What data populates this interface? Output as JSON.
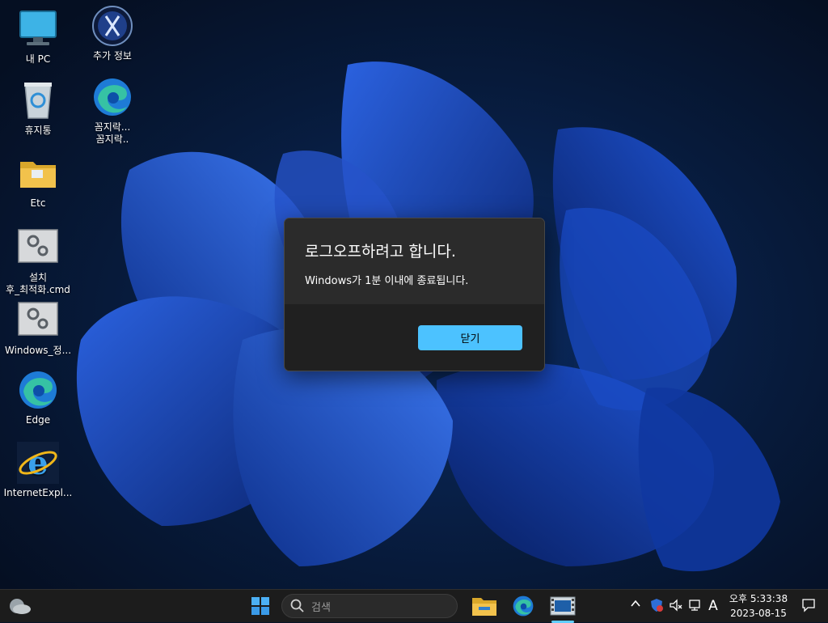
{
  "desktop": {
    "icons": [
      {
        "label": "내 PC",
        "icon": "this-pc-icon"
      },
      {
        "label": "추가 정보",
        "icon": "info-globe-icon"
      },
      {
        "label": "휴지통",
        "icon": "recycle-bin-icon"
      },
      {
        "label": "꼼지락...\n꼼지락..",
        "icon": "edge-icon"
      },
      {
        "label": "Etc",
        "icon": "folder-icon"
      },
      {
        "label": "설치\n후_최적화.cmd",
        "icon": "cmd-settings-icon"
      },
      {
        "label": "Windows_정...",
        "icon": "cmd-settings-icon"
      },
      {
        "label": "Edge",
        "icon": "edge-icon"
      },
      {
        "label": "InternetExpl...",
        "icon": "internet-explorer-icon"
      }
    ]
  },
  "dialog": {
    "title": "로그오프하려고 합니다.",
    "message": "Windows가 1분 이내에 종료됩니다.",
    "close_label": "닫기",
    "button_color": "#4cc2ff"
  },
  "taskbar": {
    "search_placeholder": "검색",
    "pinned": [
      "start-icon",
      "search-icon",
      "file-explorer-icon",
      "edge-icon",
      "media-app-icon"
    ],
    "tray": {
      "ime": "A",
      "time": "오후 5:33:38",
      "date": "2023-08-15"
    },
    "accent": "#1c1c1c"
  }
}
